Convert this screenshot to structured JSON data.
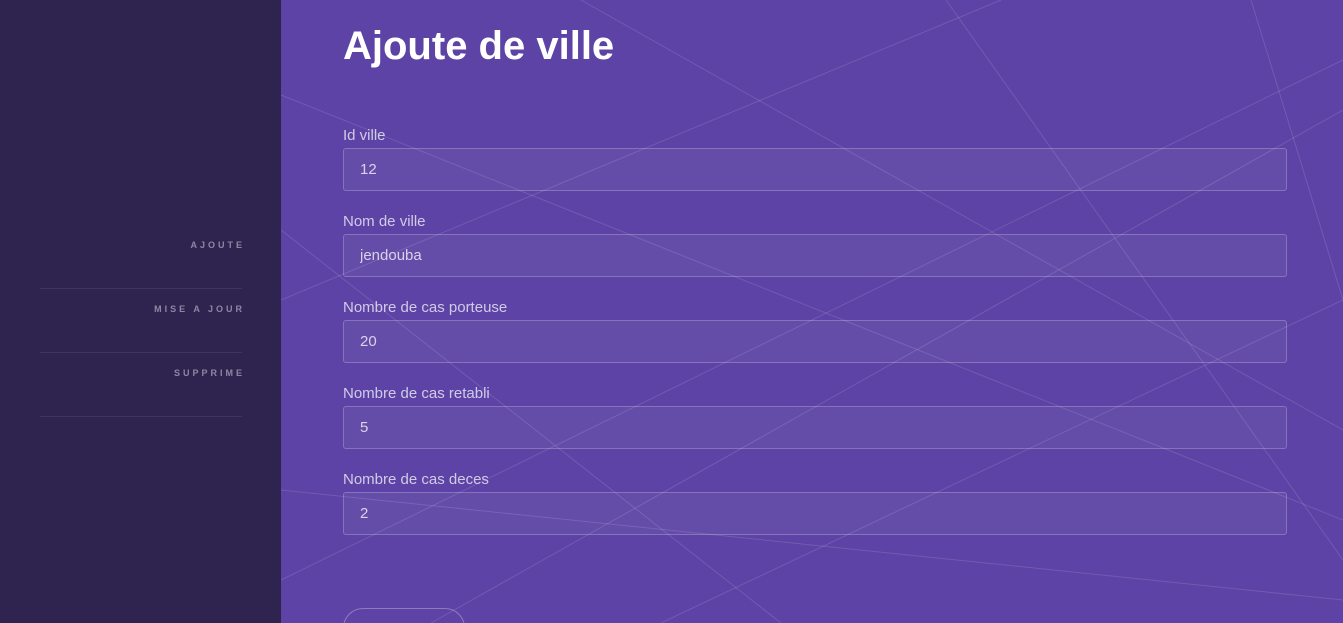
{
  "sidebar": {
    "items": [
      {
        "label": "AJOUTE"
      },
      {
        "label": "MISE A JOUR"
      },
      {
        "label": "SUPPRIME"
      }
    ]
  },
  "main": {
    "title": "Ajoute de ville",
    "fields": [
      {
        "label": "Id ville",
        "value": "12"
      },
      {
        "label": "Nom de ville",
        "value": "jendouba"
      },
      {
        "label": "Nombre de cas porteuse",
        "value": "20"
      },
      {
        "label": "Nombre de cas retabli",
        "value": "5"
      },
      {
        "label": "Nombre de cas deces",
        "value": "2"
      }
    ]
  },
  "colors": {
    "sidebar_bg": "#2f2450",
    "main_bg": "#5c43a5"
  }
}
